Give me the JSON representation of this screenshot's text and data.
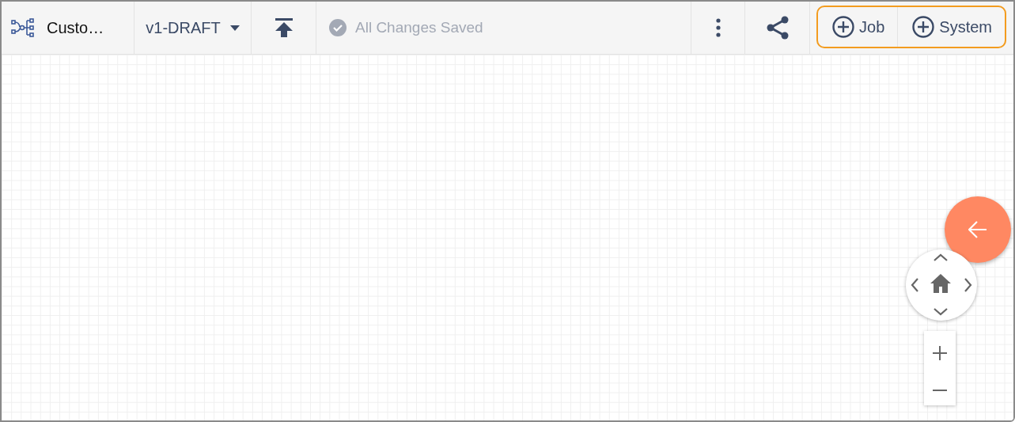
{
  "toolbar": {
    "title": "Custo…",
    "version": "v1-DRAFT",
    "save_status": "All Changes Saved",
    "add_group": {
      "highlighted": true,
      "buttons": [
        "Job",
        "System"
      ]
    }
  }
}
